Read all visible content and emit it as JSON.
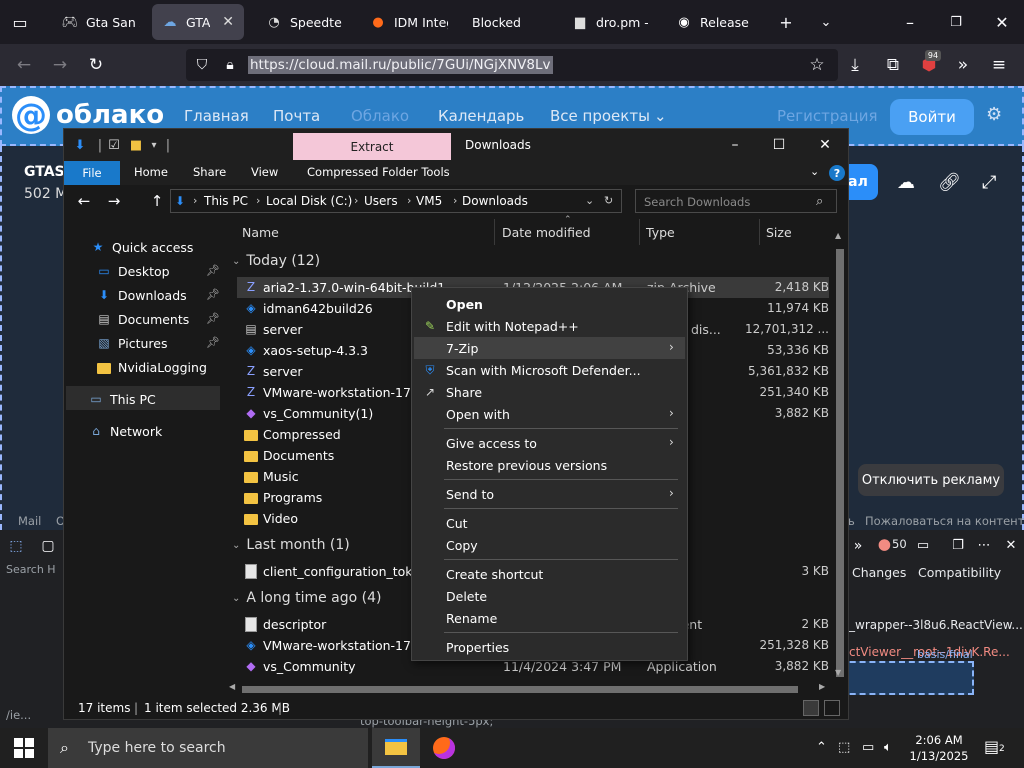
{
  "browser": {
    "tabs": [
      {
        "label": "Gta San Ar",
        "icon": "gamepad-icon"
      },
      {
        "label": "GTASAN",
        "icon": "cloud-icon",
        "active": true
      },
      {
        "label": "Speedtest",
        "icon": "speedometer-icon"
      },
      {
        "label": "IDM Integr",
        "icon": "firefox-icon"
      },
      {
        "label": "Blocked",
        "icon": ""
      },
      {
        "label": "dro.pm -",
        "icon": "folder-icon"
      },
      {
        "label": "Release ar",
        "icon": "github-icon"
      }
    ],
    "url": "https://cloud.mail.ru/public/7GUi/NGjXNV8Lv",
    "extensions_badge": "94"
  },
  "webpage": {
    "logo": "облако",
    "nav": [
      "Главная",
      "Почта",
      "Облако",
      "Календарь",
      "Все проекты"
    ],
    "register": "Регистрация",
    "login": "Войти",
    "file_title": "GTAS/",
    "file_size": "502 M",
    "download_btn": "ал",
    "ads_button": "Отключить рекламу",
    "footer_mail": "Mail",
    "footer_o": "O",
    "footer_l": "ь",
    "footer_complain": "Пожаловаться на контент"
  },
  "devtools": {
    "search": "Search H",
    "tabs": [
      "Changes",
      "Compatibility"
    ],
    "errors": "50",
    "class1": "_wrapper--3l8u6.ReactView...",
    "class2": "ctViewer__root--1divK.Re...",
    "basis": "basis/final",
    "code": "top-toolbar-height-5px;",
    "left_label": "/ie..."
  },
  "explorer": {
    "title": "Downloads",
    "extract_tab": "Extract",
    "ribbon": {
      "file": "File",
      "home": "Home",
      "share": "Share",
      "view": "View",
      "tools": "Compressed Folder Tools"
    },
    "breadcrumb": [
      "This PC",
      "Local Disk (C:)",
      "Users",
      "VM5",
      "Downloads"
    ],
    "search_placeholder": "Search Downloads",
    "nav": [
      {
        "label": "Quick access",
        "icon": "star-icon"
      },
      {
        "label": "Desktop",
        "icon": "desktop-icon",
        "pinned": true
      },
      {
        "label": "Downloads",
        "icon": "download-icon",
        "pinned": true
      },
      {
        "label": "Documents",
        "icon": "document-icon",
        "pinned": true
      },
      {
        "label": "Pictures",
        "icon": "picture-icon",
        "pinned": true
      },
      {
        "label": "NvidiaLogging",
        "icon": "folder-icon"
      },
      {
        "label": "This PC",
        "icon": "computer-icon",
        "selected": true
      },
      {
        "label": "Network",
        "icon": "network-icon"
      }
    ],
    "columns": {
      "name": "Name",
      "date": "Date modified",
      "type": "Type",
      "size": "Size"
    },
    "groups": [
      {
        "label": "Today (12)",
        "files": [
          {
            "name": "aria2-1.37.0-win-64bit-build1",
            "date": "1/12/2025 2:06 AM",
            "type": "zip Archive",
            "size": "2,418 KB",
            "icon": "zip-icon",
            "selected": true
          },
          {
            "name": "idman642build26",
            "date": "",
            "type": "ation",
            "size": "11,974 KB",
            "icon": "installer-icon"
          },
          {
            "name": "server",
            "date": "",
            "type": "virtual dis...",
            "size": "12,701,312 ...",
            "icon": "disk-icon"
          },
          {
            "name": "xaos-setup-4.3.3",
            "date": "",
            "type": "ation",
            "size": "53,336 KB",
            "icon": "installer-icon"
          },
          {
            "name": "server",
            "date": "",
            "type": "ive",
            "size": "5,361,832 KB",
            "icon": "zip-icon"
          },
          {
            "name": "VMware-workstation-17.6.2-",
            "date": "",
            "type": "ive",
            "size": "251,340 KB",
            "icon": "zip-icon"
          },
          {
            "name": "vs_Community(1)",
            "date": "",
            "type": "ation",
            "size": "3,882 KB",
            "icon": "vs-icon"
          },
          {
            "name": "Compressed",
            "date": "",
            "type": "er",
            "size": "",
            "icon": "folder-icon"
          },
          {
            "name": "Documents",
            "date": "",
            "type": "er",
            "size": "",
            "icon": "folder-icon"
          },
          {
            "name": "Music",
            "date": "",
            "type": "er",
            "size": "",
            "icon": "folder-icon"
          },
          {
            "name": "Programs",
            "date": "",
            "type": "er",
            "size": "",
            "icon": "folder-icon"
          },
          {
            "name": "Video",
            "date": "",
            "type": "er",
            "size": "",
            "icon": "folder-icon"
          }
        ]
      },
      {
        "label": "Last month (1)",
        "files": [
          {
            "name": "client_configuration_token_1",
            "date": "",
            "type": "",
            "size": "3 KB",
            "icon": "document-icon"
          }
        ]
      },
      {
        "label": "A long time ago (4)",
        "files": [
          {
            "name": "descriptor",
            "date": "",
            "type": "ocument",
            "size": "2 KB",
            "icon": "document-icon"
          },
          {
            "name": "VMware-workstation-17.6.2-",
            "date": "",
            "type": "ation",
            "size": "251,328 KB",
            "icon": "installer-icon"
          },
          {
            "name": "vs_Community",
            "date": "11/4/2024 3:47 PM",
            "type": "Application",
            "size": "3,882 KB",
            "icon": "vs-icon"
          }
        ]
      }
    ],
    "status": {
      "items": "17 items",
      "selected": "1 item selected  2.36 MB"
    }
  },
  "context_menu": [
    {
      "label": "Open",
      "bold": true,
      "icon": ""
    },
    {
      "label": "Edit with Notepad++",
      "icon": "notepad-plus-icon"
    },
    {
      "label": "7-Zip",
      "submenu": true,
      "highlight": true,
      "icon": ""
    },
    {
      "label": "Scan with Microsoft Defender...",
      "icon": "defender-shield-icon"
    },
    {
      "label": "Share",
      "icon": "share-icon"
    },
    {
      "label": "Open with",
      "submenu": true,
      "icon": ""
    },
    {
      "sep": true
    },
    {
      "label": "Give access to",
      "submenu": true,
      "icon": ""
    },
    {
      "label": "Restore previous versions",
      "icon": ""
    },
    {
      "sep": true
    },
    {
      "label": "Send to",
      "submenu": true,
      "icon": ""
    },
    {
      "sep": true
    },
    {
      "label": "Cut",
      "icon": ""
    },
    {
      "label": "Copy",
      "icon": ""
    },
    {
      "sep": true
    },
    {
      "label": "Create shortcut",
      "icon": ""
    },
    {
      "label": "Delete",
      "icon": ""
    },
    {
      "label": "Rename",
      "icon": ""
    },
    {
      "sep": true
    },
    {
      "label": "Properties",
      "icon": ""
    }
  ],
  "taskbar": {
    "search_placeholder": "Type here to search",
    "time": "2:06 AM",
    "date": "1/13/2025",
    "notifications": "2"
  }
}
